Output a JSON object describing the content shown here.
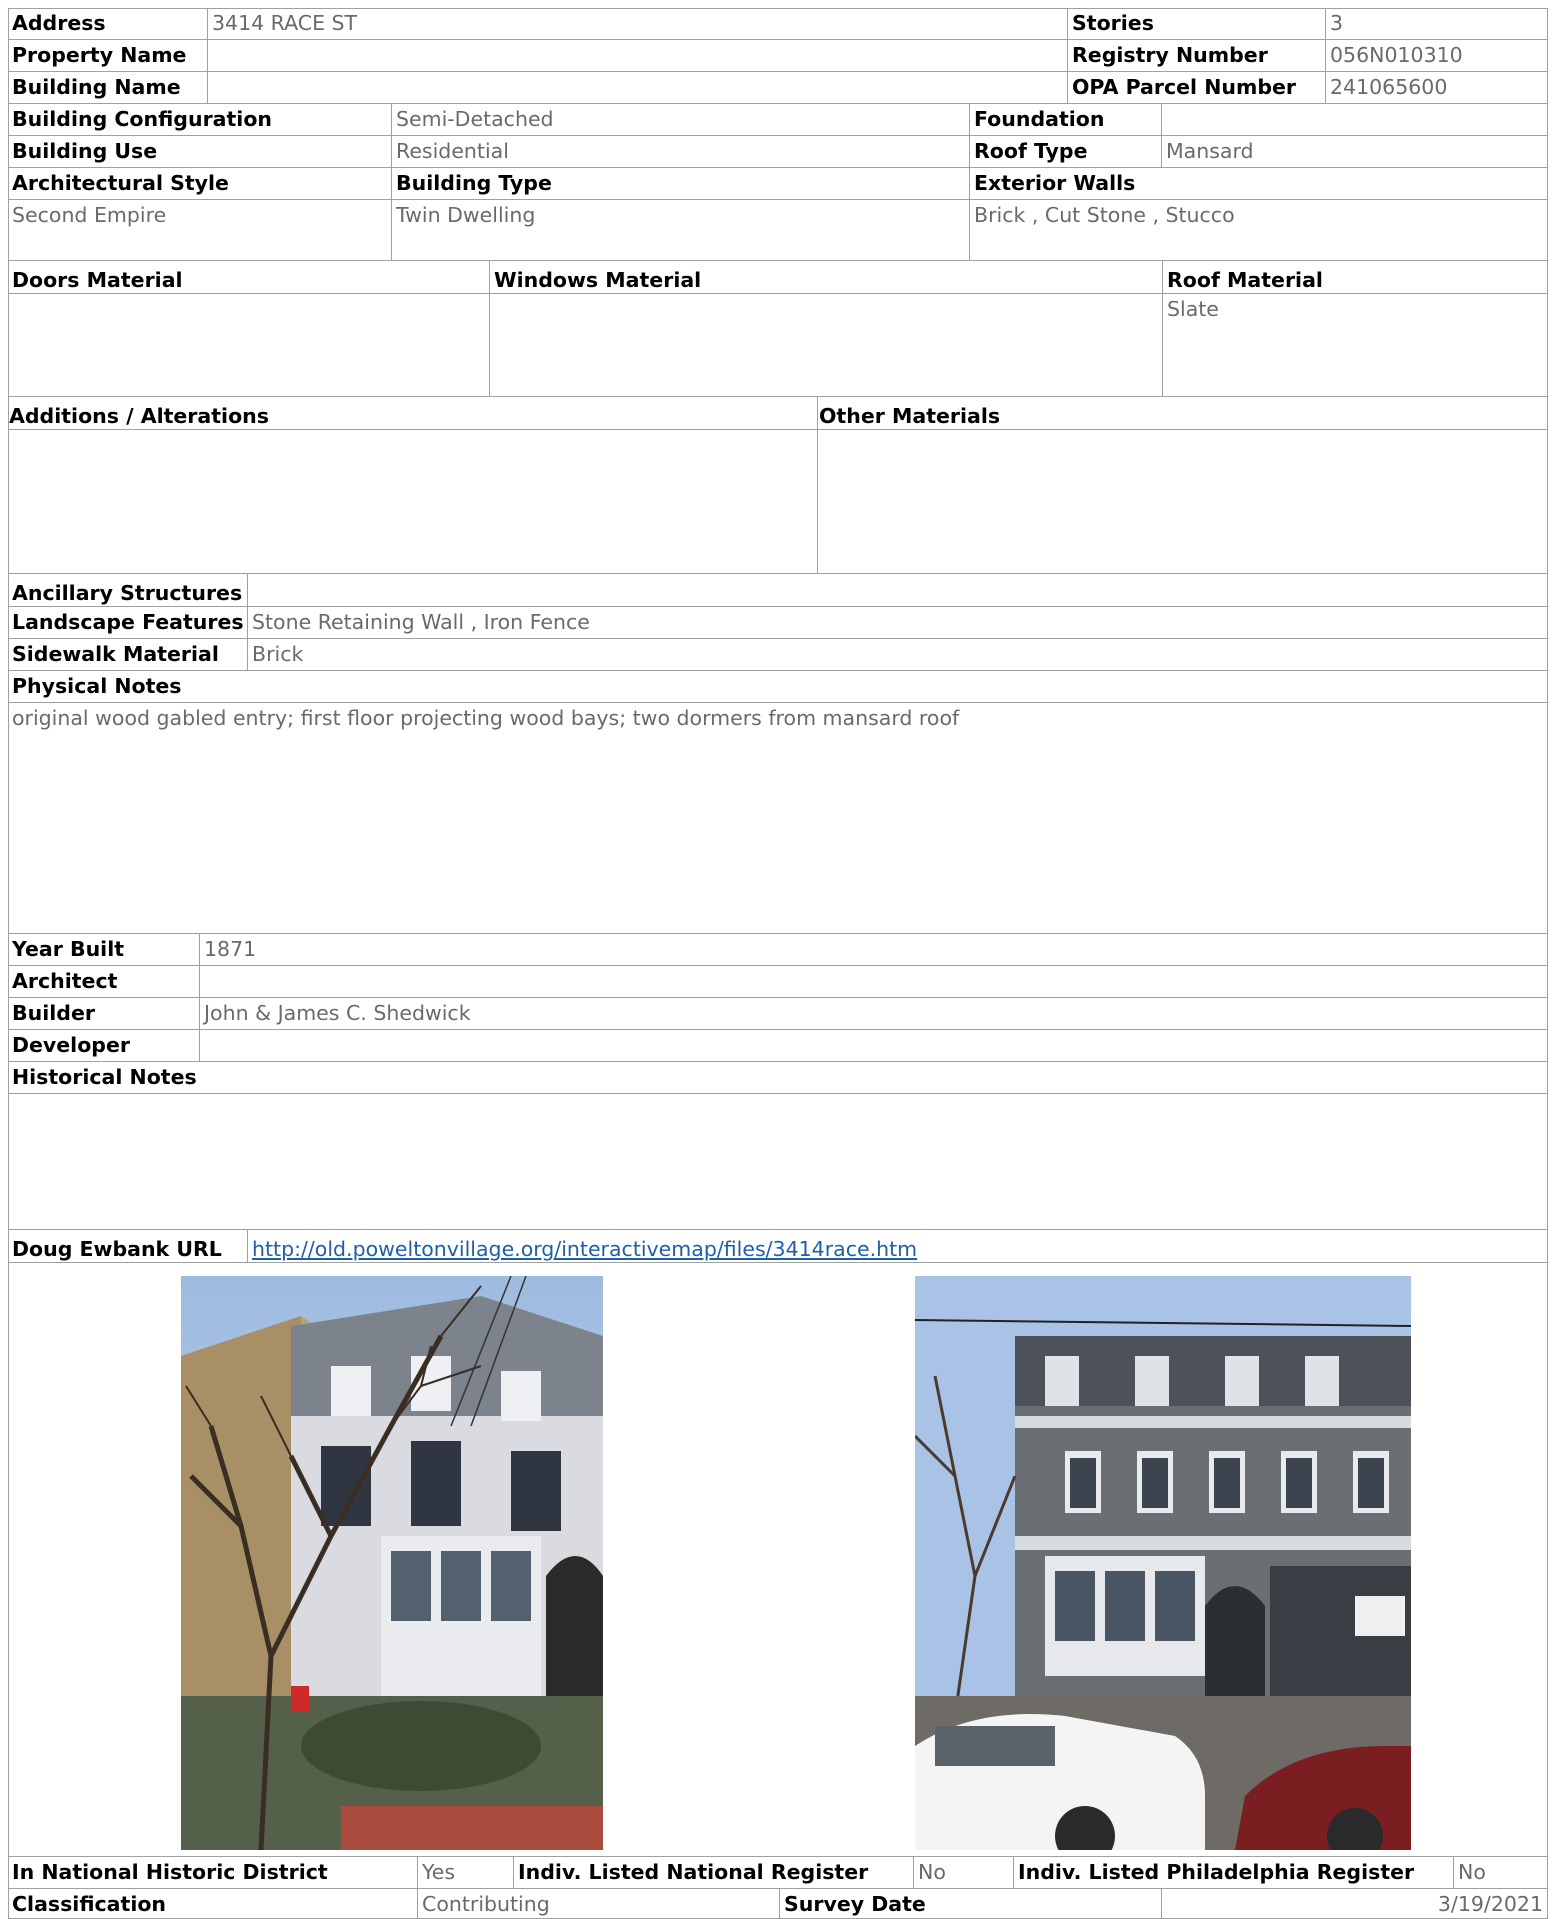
{
  "labels": {
    "address": "Address",
    "stories": "Stories",
    "property_name": "Property Name",
    "registry_number": "Registry Number",
    "building_name": "Building Name",
    "opa_parcel_number": "OPA Parcel Number",
    "building_configuration": "Building Configuration",
    "foundation": "Foundation",
    "building_use": "Building Use",
    "roof_type": "Roof Type",
    "architectural_style": "Architectural Style",
    "building_type": "Building Type",
    "exterior_walls": "Exterior Walls",
    "doors_material": "Doors Material",
    "windows_material": "Windows Material",
    "roof_material": "Roof Material",
    "additions_alterations": "Additions / Alterations",
    "other_materials": "Other Materials",
    "ancillary_structures": "Ancillary Structures",
    "landscape_features": "Landscape Features",
    "sidewalk_material": "Sidewalk Material",
    "physical_notes": "Physical Notes",
    "year_built": "Year Built",
    "architect": "Architect",
    "builder": "Builder",
    "developer": "Developer",
    "historical_notes": "Historical Notes",
    "doug_ewbank_url": "Doug Ewbank URL",
    "in_national_historic_district": "In National Historic District",
    "indiv_listed_national_register": "Indiv. Listed National Register",
    "indiv_listed_philadelphia_register": "Indiv. Listed Philadelphia Register",
    "classification": "Classification",
    "survey_date": "Survey Date"
  },
  "values": {
    "address": "3414 RACE ST",
    "stories": "3",
    "property_name": "",
    "registry_number": "056N010310",
    "building_name": "",
    "opa_parcel_number": "241065600",
    "building_configuration": "Semi-Detached",
    "foundation": "",
    "building_use": "Residential",
    "roof_type": "Mansard",
    "architectural_style": "Second Empire",
    "building_type": "Twin Dwelling",
    "exterior_walls": "Brick , Cut Stone , Stucco",
    "doors_material": "",
    "windows_material": "",
    "roof_material": "Slate",
    "additions_alterations": "",
    "other_materials": "",
    "ancillary_structures": "",
    "landscape_features": "Stone Retaining Wall , Iron Fence",
    "sidewalk_material": "Brick",
    "physical_notes": "original wood gabled entry; first floor projecting wood bays; two dormers from mansard roof",
    "year_built": "1871",
    "architect": "",
    "builder": "John & James C. Shedwick",
    "developer": "",
    "historical_notes": "",
    "doug_ewbank_url": "http://old.poweltonvillage.org/interactivemap/files/3414race.htm",
    "in_national_historic_district": "Yes",
    "indiv_listed_national_register": "No",
    "indiv_listed_philadelphia_register": "No",
    "classification": "Contributing",
    "survey_date": "3/19/2021"
  },
  "colors": {
    "border": "#a0a0a0",
    "value_text": "#6a6a6a",
    "link": "#1f5faa"
  }
}
